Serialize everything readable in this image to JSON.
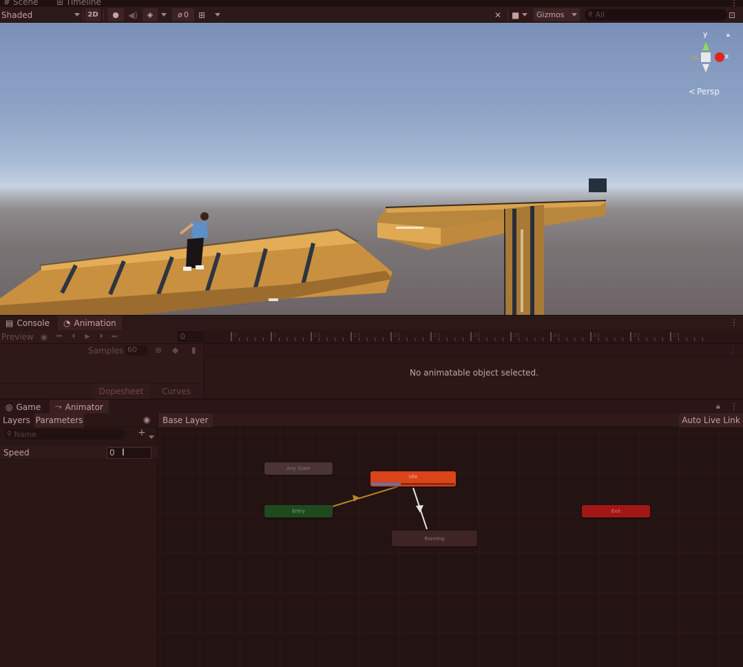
{
  "scene_window": {
    "tabs": [
      {
        "label": "Scene",
        "icon": "grid-icon"
      },
      {
        "label": "Timeline",
        "icon": "timeline-icon"
      }
    ],
    "draw_mode": "Shaded",
    "toggle_2d": "2D",
    "hidden_count": "0",
    "gizmos_label": "Gizmos",
    "search_placeholder": "All",
    "gizmo_axes": {
      "y": "y",
      "x": "x"
    },
    "projection": "Persp"
  },
  "animation_window": {
    "tabs": [
      {
        "label": "Console",
        "icon": "console-icon"
      },
      {
        "label": "Animation",
        "icon": "animation-icon"
      }
    ],
    "preview_label": "Preview",
    "frame_value": "0",
    "samples_label": "Samples",
    "samples_value": "60",
    "mode_tabs": [
      "Dopesheet",
      "Curves"
    ],
    "empty_message": "No animatable object selected.",
    "ruler_ticks": [
      "0",
      "5",
      "10",
      "15",
      "20",
      "25",
      "30",
      "35",
      "40",
      "45",
      "50",
      "55"
    ]
  },
  "animator_window": {
    "tabs": [
      {
        "label": "Game",
        "icon": "gamepad-icon"
      },
      {
        "label": "Animator",
        "icon": "animator-icon"
      }
    ],
    "left_tabs": [
      "Layers",
      "Parameters"
    ],
    "search_placeholder": "Name",
    "parameters": [
      {
        "name": "Speed",
        "value": "0"
      }
    ],
    "breadcrumb": "Base Layer",
    "auto_live_link": "Auto Live Link",
    "states": {
      "any_state": "Any State",
      "entry": "Entry",
      "idle": "Idle",
      "running": "Running",
      "exit": "Exit"
    },
    "idle_progress": 0.35
  },
  "colors": {
    "idle_state": "#d9441a",
    "entry_state": "#1e4a1e",
    "exit_state": "#a31616",
    "any_state": "#4a3434",
    "running_state": "#3f2424",
    "progress": "#3f7fd6",
    "transition_entry": "#b8862a",
    "transition_idle": "#e6e6e6"
  }
}
